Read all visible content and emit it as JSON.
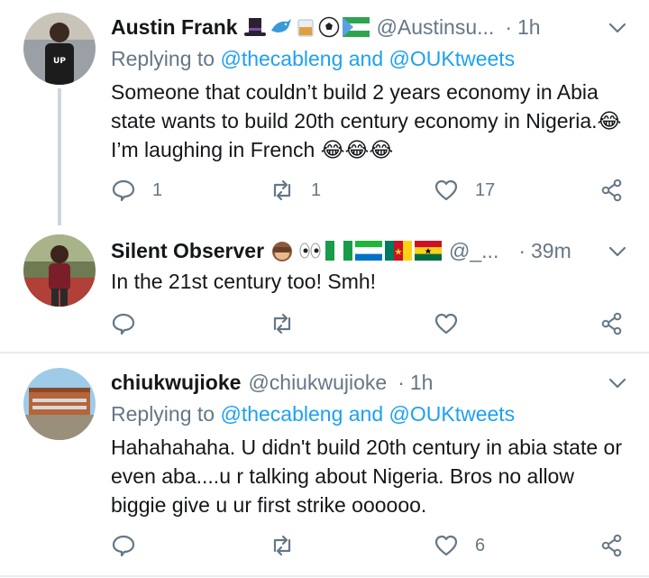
{
  "tweets": [
    {
      "name": "Austin Frank",
      "handle": "@Austinsu...",
      "dot": "·",
      "time": "1h",
      "replying_prefix": "Replying to",
      "replying_targets": "@thecableng and @OUKtweets",
      "text": "Someone that couldn’t build 2 years economy in Abia state wants to build 20th century economy in Nigeria.😂 I’m laughing in French 😂😂😂",
      "replies": "1",
      "retweets": "1",
      "likes": "17"
    },
    {
      "name": "Silent Observer",
      "handle": "@_...",
      "dot": "·",
      "time": "39m",
      "text": "In the 21st century too! Smh!",
      "replies": "",
      "retweets": "",
      "likes": ""
    },
    {
      "name": "chiukwujioke",
      "handle": "@chiukwujioke",
      "dot": "·",
      "time": "1h",
      "replying_prefix": "Replying to",
      "replying_targets": "@thecableng and @OUKtweets",
      "text": "Hahahahaha. U didn't build 20th century in abia state or even aba....u r talking about Nigeria. Bros no allow biggie give u ur first strike oooooo.",
      "replies": "",
      "retweets": "",
      "likes": "6"
    }
  ],
  "colors": {
    "link": "#1da1f2",
    "muted": "#657786",
    "text": "#14171a",
    "divider": "#e6ecf0"
  },
  "icons": [
    "reply-icon",
    "retweet-icon",
    "like-icon",
    "share-icon",
    "chevron-down-icon"
  ]
}
